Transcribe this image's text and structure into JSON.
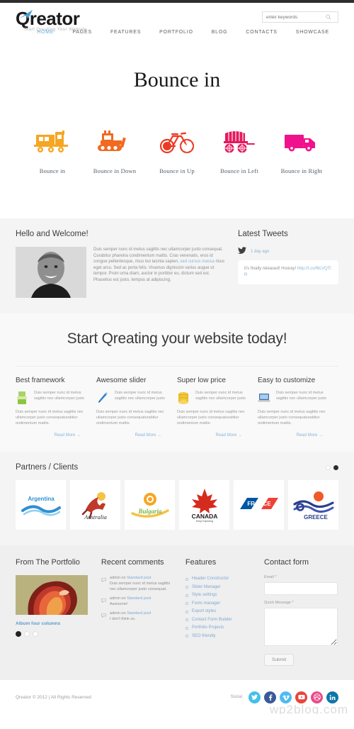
{
  "brand": {
    "logo_text": "Qreator",
    "tagline": "Start Qreating Your Website",
    "accent_blue": "#5aa9dd",
    "logo_swoosh_color": "#4a9ed6"
  },
  "search": {
    "placeholder": "enter keywords",
    "icon": "search-icon"
  },
  "nav": {
    "items": [
      {
        "label": "HOME",
        "active": true
      },
      {
        "label": "PAGES",
        "active": false
      },
      {
        "label": "FEATURES",
        "active": false
      },
      {
        "label": "PORTFOLIO",
        "active": false
      },
      {
        "label": "BLOG",
        "active": false
      },
      {
        "label": "CONTACTS",
        "active": false
      },
      {
        "label": "SHOWCASE",
        "active": false
      }
    ]
  },
  "hero": {
    "title": "Bounce in",
    "icons": [
      {
        "label": "Bounce in",
        "icon": "train-icon",
        "color": "#f5a623"
      },
      {
        "label": "Bounce in Down",
        "icon": "bulldozer-icon",
        "color": "#f06a20"
      },
      {
        "label": "Bounce in Up",
        "icon": "bicycle-icon",
        "color": "#ec3a24"
      },
      {
        "label": "Bounce in Left",
        "icon": "wagon-icon",
        "color": "#e5195e"
      },
      {
        "label": "Bounce in Right",
        "icon": "truck-icon",
        "color": "#f0128c"
      }
    ]
  },
  "welcome": {
    "title": "Hello and Welcome!",
    "avatar": "portrait-photo",
    "paragraph_1": "Duis semper nunc id metus sagittis nec ullamcorper justo consequat. Curabitur pharetra condimentum mattis. Cras venenatis, eros id congue pellentesque, risus leo lacinia sapien, ",
    "paragraph_link": "sed cursus massa",
    "paragraph_2": " risus eget arcu. Sed ac porta felis. Vivamus dignissim varius augue ut tempor. Proin urna diam, auctor in porttitor eu, dictum sed est. Phasellus est justo, tempus at adipiscing."
  },
  "tweets": {
    "title": "Latest Tweets",
    "icon": "twitter-bird-icon",
    "date": "1 day ago",
    "text": "it's finally released! Hooray! ",
    "link": "http://t.co/fbLVQTiR"
  },
  "cta": {
    "title": "Start Qreating your website today!",
    "columns": [
      {
        "heading": "Best framework",
        "icon": "green-brush-icon",
        "icon_color": "#8cc63f",
        "lead": "Duis semper nunc id metus sagittis nec ullamcorper justo",
        "body": "Duis semper nunc id metus sagittis nec ullamcorper justo consequaturabitur ondimentum mattis.",
        "readmore": "Read More →"
      },
      {
        "heading": "Awesome slider",
        "icon": "blue-pencil-icon",
        "icon_color": "#2f7fd1",
        "lead": "Duis semper nunc id metus sagittis nec ullamcorper justo",
        "body": "Duis semper nunc id metus sagittis nec ullamcorper justo consequaturabitur ondimentum mattis.",
        "readmore": "Read More →"
      },
      {
        "heading": "Super low price",
        "icon": "gold-coins-icon",
        "icon_color": "#e8b121",
        "lead": "Duis semper nunc id metus sagittis nec ullamcorper justo",
        "body": "Duis semper nunc id metus sagittis nec ullamcorper justo consequaturabitur ondimentum mattis.",
        "readmore": "Read More →"
      },
      {
        "heading": "Easy to customize",
        "icon": "laptop-icon",
        "icon_color": "#3e6fa8",
        "lead": "Duis semper nunc id metus sagittis nec ullamcorper justo",
        "body": "Duis semper nunc id metus sagittis nec ullamcorper justo consequaturabitur ondimentum mattis.",
        "readmore": "Read More →"
      }
    ]
  },
  "partners": {
    "title": "Partners / Clients",
    "pagination": [
      {
        "active": false
      },
      {
        "active": true
      }
    ],
    "logos": [
      {
        "name": "Argentina",
        "icon": "argentina-logo"
      },
      {
        "name": "Australia",
        "icon": "australia-logo"
      },
      {
        "name": "Bulgaria",
        "icon": "bulgaria-logo"
      },
      {
        "name": "CANADA",
        "sub": "Keep Exploring",
        "icon": "canada-logo"
      },
      {
        "name": "FRANCE",
        "icon": "france-logo"
      },
      {
        "name": "GREECE",
        "icon": "greece-logo"
      }
    ]
  },
  "footer": {
    "portfolio": {
      "title": "From The Portfolio",
      "thumb": "portfolio-thumbnail",
      "link": "Album four columns",
      "dots": [
        {
          "active": true
        },
        {
          "active": false
        },
        {
          "active": false
        }
      ]
    },
    "comments": {
      "title": "Recent comments",
      "items": [
        {
          "author": "admin on ",
          "post": "Standard post",
          "body": "Duis semper nunc id metus sagittis nec ullamcorper justo consequat."
        },
        {
          "author": "admin on ",
          "post": "Standard post",
          "body": "Awesome!"
        },
        {
          "author": "admin on ",
          "post": "Standard post",
          "body": "I don't think so."
        }
      ]
    },
    "features": {
      "title": "Features",
      "items": [
        "Header Constructor",
        "Slider Manager",
        "Style settings",
        "Fonts manager",
        "Export styles",
        "Contact Form Builder",
        "Portfolio Projects",
        "SEO friendly"
      ]
    },
    "contact": {
      "title": "Contact form",
      "email_label": "Email *",
      "email_value": "",
      "message_label": "Quick Message *",
      "message_value": "",
      "submit_label": "Submit"
    }
  },
  "bottom": {
    "copyright": "Qreator © 2012 | All Rights Reserved",
    "social_label": "Social",
    "social": [
      {
        "name": "twitter-icon",
        "glyph": "✉",
        "color": "#45c0e8"
      },
      {
        "name": "facebook-icon",
        "glyph": "f",
        "color": "#3b5998"
      },
      {
        "name": "vimeo-icon",
        "glyph": "v",
        "color": "#4ebbf0"
      },
      {
        "name": "youtube-icon",
        "glyph": "▶",
        "color": "#e8453c"
      },
      {
        "name": "dribbble-icon",
        "glyph": "●",
        "color": "#ea4c89"
      },
      {
        "name": "linkedin-icon",
        "glyph": "in",
        "color": "#0e76a8"
      }
    ],
    "watermark": "wp2blog.com"
  }
}
